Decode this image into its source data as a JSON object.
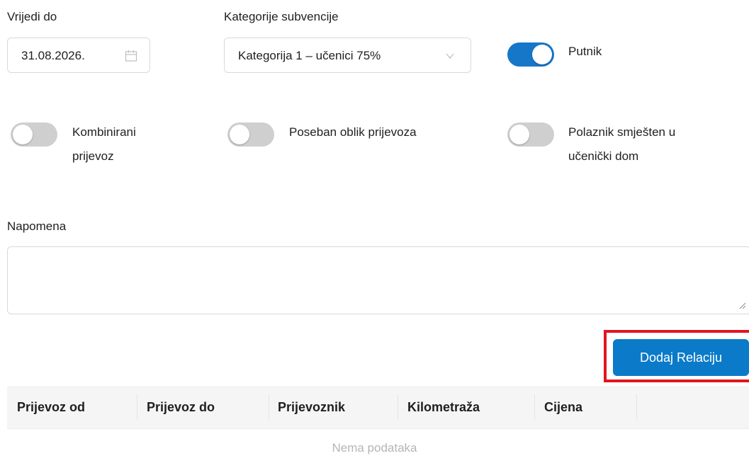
{
  "validity": {
    "label": "Vrijedi do",
    "value": "31.08.2026."
  },
  "category": {
    "label": "Kategorije subvencije",
    "value": "Kategorija 1 – učenici 75%"
  },
  "toggles": {
    "putnik": {
      "label": "Putnik",
      "on": true
    },
    "kombinirani_line1": "Kombinirani",
    "kombinirani_line2": "prijevoz",
    "poseban": "Poseban oblik prijevoza",
    "polaznik_line1": "Polaznik smješten u",
    "polaznik_line2": "učenički dom"
  },
  "note": {
    "label": "Napomena",
    "value": ""
  },
  "actions": {
    "add_relation": "Dodaj Relaciju"
  },
  "table": {
    "columns": [
      "Prijevoz od",
      "Prijevoz do",
      "Prijevoznik",
      "Kilometraža",
      "Cijena"
    ],
    "empty_text": "Nema podataka"
  },
  "colors": {
    "primary": "#0b7ac9",
    "toggle_on": "#1677c9",
    "toggle_off": "#cfcfcf",
    "highlight": "#e0161f"
  }
}
